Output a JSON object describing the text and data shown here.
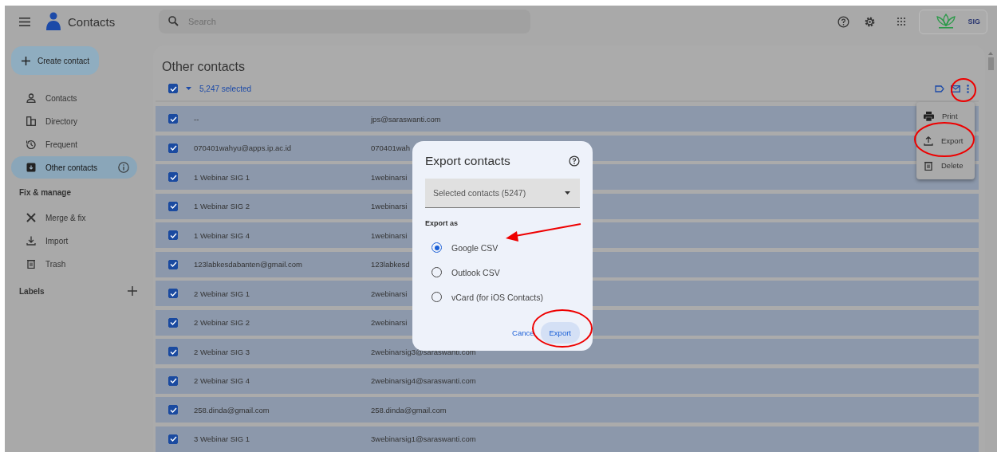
{
  "header": {
    "app_title": "Contacts",
    "search": {
      "placeholder": "Search"
    },
    "account_label": "SIG"
  },
  "sidebar": {
    "create_button": "Create contact",
    "items": [
      {
        "label": "Contacts",
        "selected": false
      },
      {
        "label": "Directory",
        "selected": false
      },
      {
        "label": "Frequent",
        "selected": false
      },
      {
        "label": "Other contacts",
        "selected": true
      }
    ],
    "section_title": "Fix & manage",
    "manage_items": [
      {
        "label": "Merge & fix"
      },
      {
        "label": "Import"
      },
      {
        "label": "Trash"
      }
    ],
    "labels_title": "Labels"
  },
  "main": {
    "title": "Other contacts",
    "select_all_checked": true,
    "selection_label": "5,247 selected",
    "rows": [
      {
        "name": "--",
        "email": "jps@saraswanti.com",
        "checked": true
      },
      {
        "name": "070401wahyu@apps.ip.ac.id",
        "email": "070401wah",
        "checked": true
      },
      {
        "name": "1 Webinar SIG 1",
        "email": "1webinarsi",
        "checked": true
      },
      {
        "name": "1 Webinar SIG 2",
        "email": "1webinarsi",
        "checked": true
      },
      {
        "name": "1 Webinar SIG 4",
        "email": "1webinarsi",
        "checked": true
      },
      {
        "name": "123labkesdabanten@gmail.com",
        "email": "123labkesd",
        "checked": true
      },
      {
        "name": "2 Webinar SIG 1",
        "email": "2webinarsi",
        "checked": true
      },
      {
        "name": "2 Webinar SIG 2",
        "email": "2webinarsi",
        "checked": true
      },
      {
        "name": "2 Webinar SIG 3",
        "email": "2webinarsig3@saraswanti.com",
        "checked": true
      },
      {
        "name": "2 Webinar SIG 4",
        "email": "2webinarsig4@saraswanti.com",
        "checked": true
      },
      {
        "name": "258.dinda@gmail.com",
        "email": "258.dinda@gmail.com",
        "checked": true
      },
      {
        "name": "3 Webinar SIG 1",
        "email": "3webinarsig1@saraswanti.com",
        "checked": true
      }
    ]
  },
  "more_menu": {
    "items": [
      {
        "label": "Print"
      },
      {
        "label": "Export"
      },
      {
        "label": "Delete"
      }
    ]
  },
  "dialog": {
    "title": "Export contacts",
    "dropdown_value": "Selected contacts (5247)",
    "section_label": "Export as",
    "options": [
      {
        "label": "Google CSV",
        "selected": true
      },
      {
        "label": "Outlook CSV",
        "selected": false
      },
      {
        "label": "vCard (for iOS Contacts)",
        "selected": false
      }
    ],
    "cancel_button": "Cance",
    "export_button": "Export"
  }
}
